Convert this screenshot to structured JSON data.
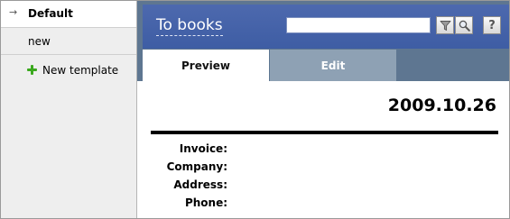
{
  "sidebar": {
    "items": [
      {
        "label": "Default",
        "marker": "→"
      },
      {
        "label": "new"
      },
      {
        "label": "New template",
        "icon": "plus-icon"
      }
    ]
  },
  "header": {
    "title": "To books",
    "search": {
      "value": "",
      "placeholder": ""
    },
    "buttons": {
      "filter_icon": "filter-icon",
      "search_icon": "search-icon",
      "help_label": "?"
    }
  },
  "tabs": [
    {
      "label": "Preview",
      "active": true
    },
    {
      "label": "Edit",
      "active": false
    }
  ],
  "document": {
    "date": "2009.10.26",
    "fields": [
      {
        "label": "Invoice:",
        "value": ""
      },
      {
        "label": "Company:",
        "value": ""
      },
      {
        "label": "Address:",
        "value": ""
      },
      {
        "label": "Phone:",
        "value": ""
      }
    ]
  },
  "colors": {
    "header_blue": "#4062a8",
    "tabbar_slate": "#5e7691",
    "inactive_tab": "#8ea1b4",
    "plus_green": "#3aa81e"
  }
}
